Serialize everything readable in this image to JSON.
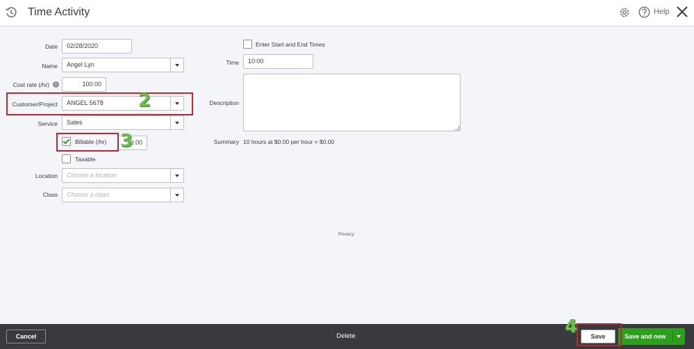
{
  "header": {
    "title": "Time Activity",
    "help_label": "Help"
  },
  "form": {
    "date": {
      "label": "Date",
      "value": "02/28/2020"
    },
    "name": {
      "label": "Name",
      "value": "Angel Lyn"
    },
    "cost_rate": {
      "label": "Cost rate (/hr)",
      "value": "100.00"
    },
    "customer": {
      "label": "Customer/Project",
      "value": "ANGEL 5678"
    },
    "service": {
      "label": "Service",
      "value": "Sales"
    },
    "billable": {
      "label": "Billable (/hr)",
      "checked": true,
      "rate_value": "0.00"
    },
    "taxable": {
      "label": "Taxable",
      "checked": false
    },
    "location": {
      "label": "Location",
      "placeholder": "Choose a location"
    },
    "class": {
      "label": "Class",
      "placeholder": "Choose a class"
    },
    "start_end": {
      "label": "Enter Start and End Times",
      "checked": false
    },
    "time": {
      "label": "Time",
      "value": "10:00"
    },
    "description": {
      "label": "Description",
      "value": ""
    },
    "summary": {
      "label": "Summary",
      "value": "10 hours at $0.00 per hour = $0.00"
    }
  },
  "annotations": {
    "step2": "2",
    "step3": "3",
    "step4": "4"
  },
  "privacy": "Privacy",
  "footer": {
    "cancel": "Cancel",
    "delete": "Delete",
    "save": "Save",
    "save_new": "Save and new"
  },
  "colors": {
    "accent_green": "#2ca01c",
    "annotation_red": "#c0262d",
    "annotation_green": "#6cc04a",
    "footer_bg": "#393a3d"
  }
}
